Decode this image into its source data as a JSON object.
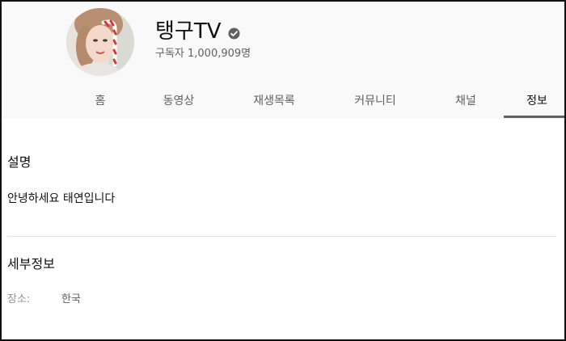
{
  "channel": {
    "name": "탱구TV",
    "subscribers": "구독자 1,000,909명",
    "verified": true
  },
  "tabs": [
    {
      "label": "홈",
      "active": false
    },
    {
      "label": "동영상",
      "active": false
    },
    {
      "label": "재생목록",
      "active": false
    },
    {
      "label": "커뮤니티",
      "active": false
    },
    {
      "label": "채널",
      "active": false
    },
    {
      "label": "정보",
      "active": true
    }
  ],
  "about": {
    "description_title": "설명",
    "description_text": "안녕하세요 태연입니다",
    "details_title": "세부정보",
    "location_label": "장소:",
    "location_value": "한국"
  },
  "colors": {
    "header_bg": "#f9f9f9",
    "text_primary": "#0f0f0f",
    "text_secondary": "#606060",
    "active_tab_underline": "#606060"
  },
  "icons": {
    "verified": "verified-check-icon"
  }
}
